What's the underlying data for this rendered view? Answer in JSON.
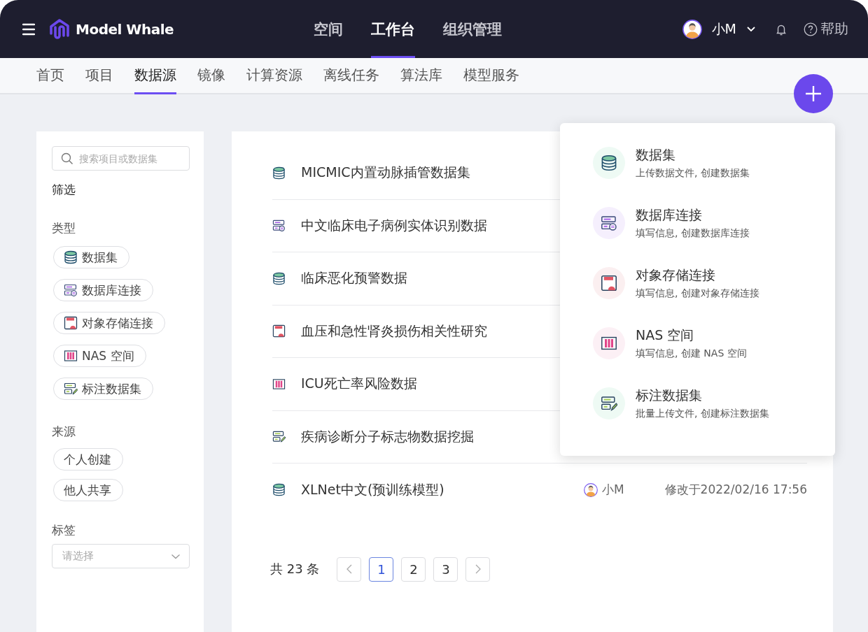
{
  "header": {
    "logo_text": "Model Whale",
    "nav": [
      {
        "label": "空间",
        "selected": false
      },
      {
        "label": "工作台",
        "selected": true
      },
      {
        "label": "组织管理",
        "selected": false
      }
    ],
    "user": {
      "name": "小M"
    },
    "help": "帮助"
  },
  "subnav": [
    {
      "label": "首页",
      "selected": false
    },
    {
      "label": "项目",
      "selected": false
    },
    {
      "label": "数据源",
      "selected": true
    },
    {
      "label": "镜像",
      "selected": false
    },
    {
      "label": "计算资源",
      "selected": false
    },
    {
      "label": "离线任务",
      "selected": false
    },
    {
      "label": "算法库",
      "selected": false
    },
    {
      "label": "模型服务",
      "selected": false
    }
  ],
  "sidebar": {
    "search": {
      "placeholder": "搜索项目或数据集"
    },
    "filter_title": "筛选",
    "type_section": {
      "title": "类型",
      "chips": [
        {
          "label": "数据集",
          "kind": "dataset"
        },
        {
          "label": "数据库连接",
          "kind": "database"
        },
        {
          "label": "对象存储连接",
          "kind": "storage"
        },
        {
          "label": "NAS 空间",
          "kind": "nas"
        },
        {
          "label": "标注数据集",
          "kind": "annotation"
        }
      ]
    },
    "source_section": {
      "title": "来源",
      "chips": [
        "个人创建",
        "他人共享"
      ]
    },
    "tag_section": {
      "title": "标签",
      "select": {
        "placeholder": "请选择"
      }
    }
  },
  "list": {
    "rows": [
      {
        "name": "MICMIC内置动脉插管数据集",
        "kind": "dataset"
      },
      {
        "name": "中文临床电子病例实体识别数据",
        "kind": "database"
      },
      {
        "name": "临床恶化预警数据",
        "kind": "dataset"
      },
      {
        "name": "血压和急性肾炎损伤相关性研究",
        "kind": "storage"
      },
      {
        "name": "ICU死亡率风险数据",
        "kind": "nas"
      },
      {
        "name": "疾病诊断分子标志物数据挖掘",
        "kind": "annotation"
      },
      {
        "name": "XLNet中文(预训练模型)",
        "kind": "dataset",
        "owner": "小M",
        "modified": "修改于2022/02/16 17:56"
      }
    ],
    "pagination": {
      "total": "共 23 条",
      "pages": [
        {
          "label": "1",
          "selected": true
        },
        {
          "label": "2",
          "selected": false
        },
        {
          "label": "3",
          "selected": false
        }
      ]
    }
  },
  "create_menu": {
    "items": [
      {
        "title": "数据集",
        "description": "上传数据文件, 创建数据集",
        "kind": "dataset"
      },
      {
        "title": "数据库连接",
        "description": "填写信息, 创建数据库连接",
        "kind": "database"
      },
      {
        "title": "对象存储连接",
        "description": "填写信息, 创建对象存储连接",
        "kind": "storage"
      },
      {
        "title": "NAS 空间",
        "description": "填写信息, 创建 NAS 空间",
        "kind": "nas"
      },
      {
        "title": "标注数据集",
        "description": "批量上传文件, 创建标注数据集",
        "kind": "annotation"
      }
    ]
  }
}
